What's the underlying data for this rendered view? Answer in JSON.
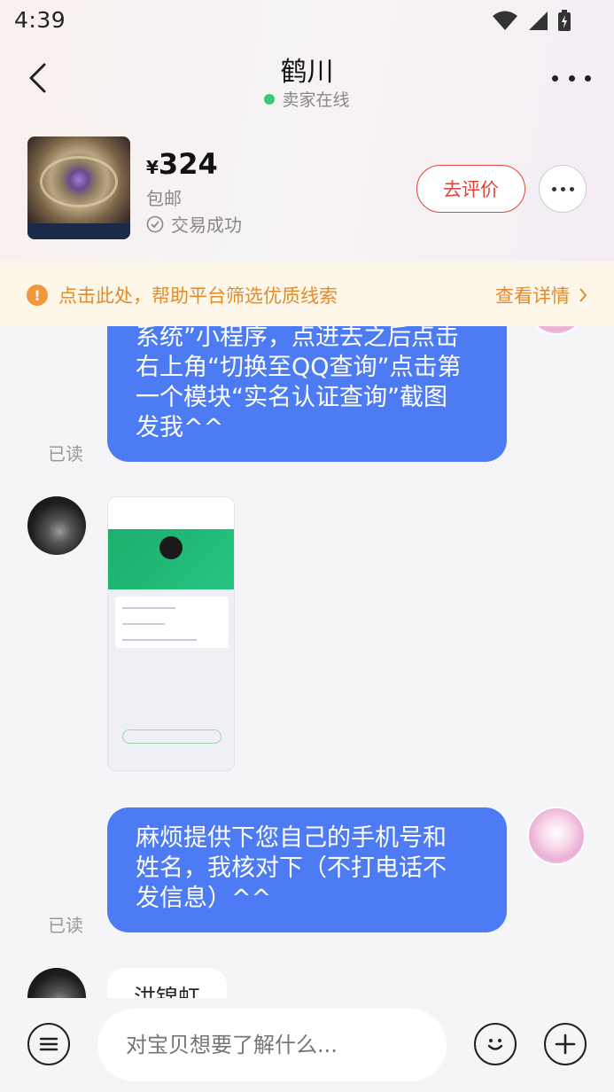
{
  "status_bar": {
    "time": "4:39"
  },
  "nav": {
    "title": "鹤川",
    "seller_status": "卖家在线"
  },
  "product": {
    "currency": "¥",
    "price": "324",
    "shipping": "包邮",
    "deal_status": "交易成功",
    "rate_button": "去评价"
  },
  "notice": {
    "text": "点击此处，帮助平台筛选优质线索",
    "link": "查看详情"
  },
  "messages": [
    {
      "from": "me",
      "lines": [
        "系统”小程序，点进去之后点击",
        "右上角“切换至QQ查询”点击第",
        "一个模块“实名认证查询”截图",
        "发我^^"
      ],
      "read": "已读"
    },
    {
      "from": "other",
      "type": "image"
    },
    {
      "from": "me",
      "lines": [
        "麻烦提供下您自己的手机号和",
        "姓名，我核对下（不打电话不",
        "发信息）^^"
      ],
      "read": "已读"
    },
    {
      "from": "other",
      "text": "洪锦虹"
    }
  ],
  "input": {
    "placeholder": "对宝贝想要了解什么..."
  },
  "colors": {
    "bubble_out": "#4d7bf3",
    "accent_red": "#e0443a",
    "notice_orange": "#e38a2c",
    "online_green": "#3cc77a"
  }
}
